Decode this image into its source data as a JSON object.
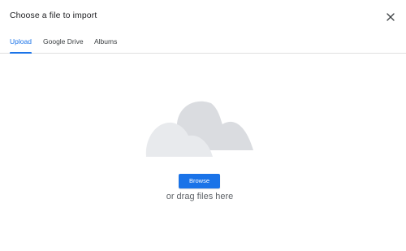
{
  "dialog": {
    "title": "Choose a file to import",
    "close_icon": "close-icon"
  },
  "tabs": [
    {
      "label": "Upload",
      "active": true
    },
    {
      "label": "Google Drive",
      "active": false
    },
    {
      "label": "Albums",
      "active": false
    }
  ],
  "upload": {
    "illustration_icon": "cloud-icon",
    "browse_label": "Browse",
    "drag_text": "or drag files here"
  },
  "colors": {
    "accent": "#1a73e8",
    "cloud_back": "#dadce0",
    "cloud_front": "#e8eaed"
  }
}
